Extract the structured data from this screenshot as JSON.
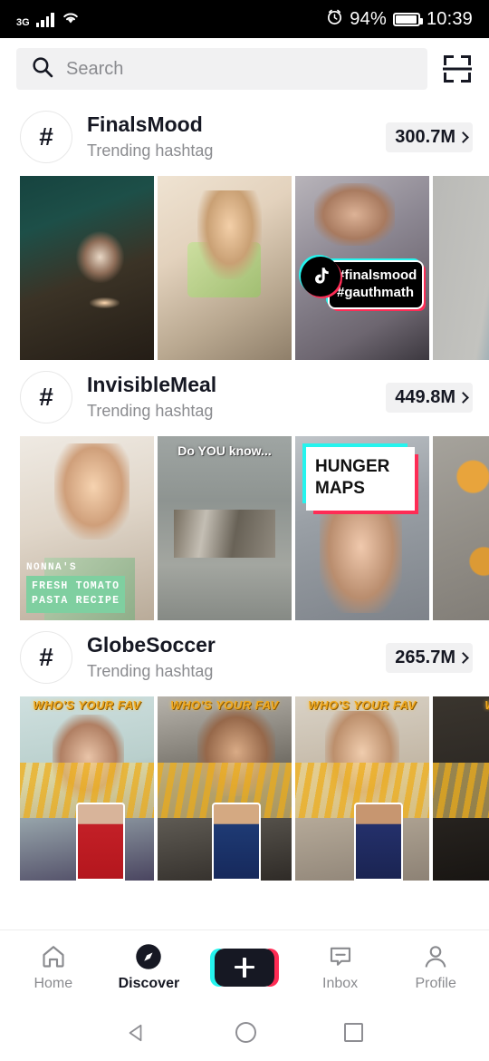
{
  "status_bar": {
    "network_type": "3G",
    "signal_icon": "signal-bars-icon",
    "wifi_icon": "wifi-icon",
    "alarm_icon": "alarm-clock-icon",
    "battery_percent": "94%",
    "battery_icon": "battery-icon",
    "time": "10:39"
  },
  "header": {
    "search_icon": "search-icon",
    "search_value": "",
    "search_placeholder": "Search",
    "scan_icon": "qr-scan-icon"
  },
  "hashtags": [
    {
      "avatar_glyph": "#",
      "name": "FinalsMood",
      "subtitle": "Trending hashtag",
      "count": "300.7M",
      "thumbs": [
        {
          "art": "t-desk",
          "overlay": "none"
        },
        {
          "art": "t-read",
          "overlay": "none"
        },
        {
          "art": "t-tag",
          "overlay": "tiktok-caption",
          "caption_line1": "#finalsmood",
          "caption_line2": "#gauthmath"
        },
        {
          "art": "t-edge",
          "overlay": "none"
        }
      ]
    },
    {
      "avatar_glyph": "#",
      "name": "InvisibleMeal",
      "subtitle": "Trending hashtag",
      "count": "449.8M",
      "thumbs": [
        {
          "art": "t-cook",
          "overlay": "nonna",
          "nonna_title": "NONNA'S",
          "nonna_line1": "FRESH TOMATO",
          "nonna_line2": "PASTA RECIPE"
        },
        {
          "art": "t-water",
          "overlay": "doyou",
          "doyou_text": "Do YOU know..."
        },
        {
          "art": "t-hunger",
          "overlay": "hunger",
          "hunger_line1": "HUNGER",
          "hunger_line2": "MAPS"
        },
        {
          "art": "t-food",
          "overlay": "none"
        }
      ]
    },
    {
      "avatar_glyph": "#",
      "name": "GlobeSoccer",
      "subtitle": "Trending hashtag",
      "count": "265.7M",
      "thumbs": [
        {
          "art": "t-soc1",
          "overlay": "fav",
          "fav_text": "WHO'S YOUR FAV",
          "player": "pc-red"
        },
        {
          "art": "t-soc2",
          "overlay": "fav",
          "fav_text": "WHO'S YOUR FAV",
          "player": "pc-blue"
        },
        {
          "art": "t-soc3",
          "overlay": "fav",
          "fav_text": "WHO'S YOUR FAV",
          "player": "pc-navy"
        },
        {
          "art": "t-soc4",
          "overlay": "fav",
          "fav_text": "WHO",
          "player": "none"
        }
      ]
    }
  ],
  "tabbar": {
    "items": [
      {
        "icon": "home-icon",
        "label": "Home",
        "active": false
      },
      {
        "icon": "compass-icon",
        "label": "Discover",
        "active": true
      },
      {
        "icon": "plus-icon",
        "label": "",
        "active": false
      },
      {
        "icon": "inbox-icon",
        "label": "Inbox",
        "active": false
      },
      {
        "icon": "person-icon",
        "label": "Profile",
        "active": false
      }
    ]
  },
  "android_nav": {
    "back_icon": "back-triangle-icon",
    "home_icon": "home-circle-icon",
    "recents_icon": "recents-square-icon"
  },
  "colors": {
    "tiktok_cyan": "#25f4ee",
    "tiktok_pink": "#fe2c55",
    "text_primary": "#161823",
    "text_secondary": "#8a8b8f",
    "chip_bg": "#f1f1f2"
  }
}
